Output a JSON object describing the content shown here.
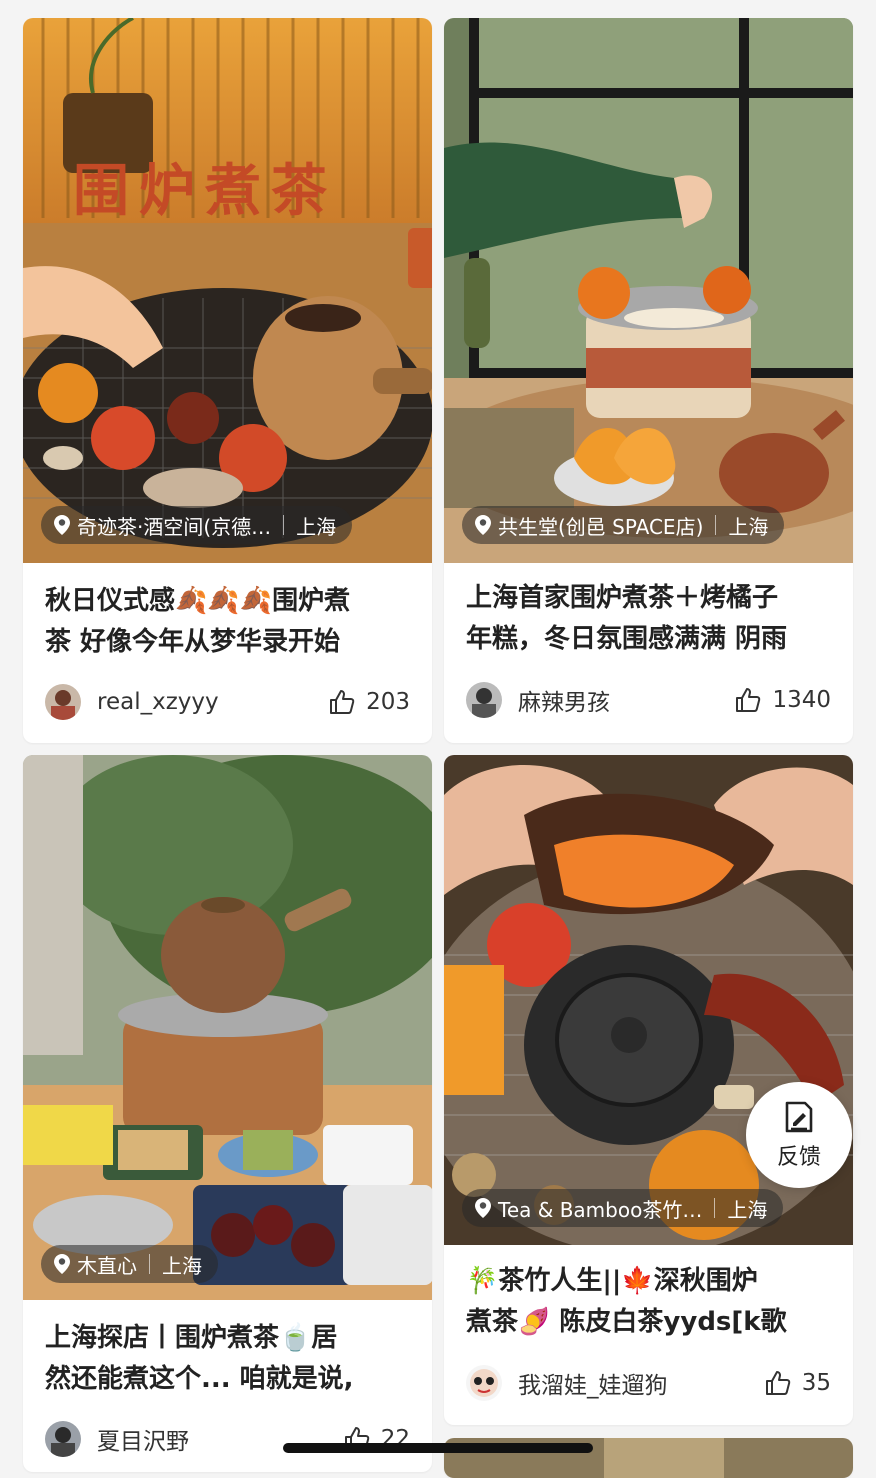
{
  "feed": [
    {
      "cover_text": "围炉煮茶",
      "location": "奇迹茶·酒空间(京德…",
      "city": "上海",
      "title_line1": "秋日仪式感🍂🍂🍂围炉煮",
      "title_line2": "茶 好像今年从梦华录开始",
      "username": "real_xzyyy",
      "likes": "203"
    },
    {
      "location": "共生堂(创邑 SPACE店)",
      "city": "上海",
      "title_line1": "上海首家围炉煮茶＋烤橘子",
      "title_line2": "年糕，冬日氛围感满满 阴雨",
      "username": "麻辣男孩",
      "likes": "1340"
    },
    {
      "location": "木直心",
      "city": "上海",
      "title_line1": "上海探店丨围炉煮茶🍵居",
      "title_line2": "然还能煮这个... 咱就是说,",
      "username": "夏目沢野",
      "likes": "22"
    },
    {
      "location": "Tea & Bamboo茶竹…",
      "city": "上海",
      "title_line1": "🎋茶竹人生||🍁深秋围炉",
      "title_line2": "煮茶🍠 陈皮白茶yyds[k歌",
      "username": "我溜娃_娃遛狗",
      "likes": "35"
    }
  ],
  "feedback_label": "反馈",
  "icons": [
    "location-pin-icon",
    "thumbs-up-icon",
    "feedback-edit-icon"
  ]
}
